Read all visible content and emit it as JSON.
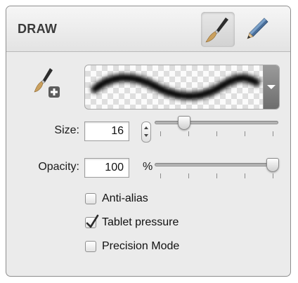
{
  "panel": {
    "title": "DRAW",
    "tools": [
      {
        "icon": "paintbrush-icon",
        "active": true
      },
      {
        "icon": "pencil-icon",
        "active": false
      }
    ]
  },
  "brush": {
    "add_icon": "add-brush-icon",
    "preview_icon": "brush-stroke-preview",
    "dropdown_icon": "chevron-down-icon"
  },
  "size": {
    "label": "Size:",
    "value": "16",
    "slider_fraction": 0.21
  },
  "opacity": {
    "label": "Opacity:",
    "value": "100",
    "unit": "%",
    "slider_fraction": 1.0
  },
  "options": [
    {
      "label": "Anti-alias",
      "checked": false
    },
    {
      "label": "Tablet pressure",
      "checked": true
    },
    {
      "label": "Precision Mode",
      "checked": false
    }
  ],
  "colors": {
    "panel_bg": "#ebebeb",
    "header_bg": "#f0f0f0",
    "border": "#8e8e8e"
  }
}
